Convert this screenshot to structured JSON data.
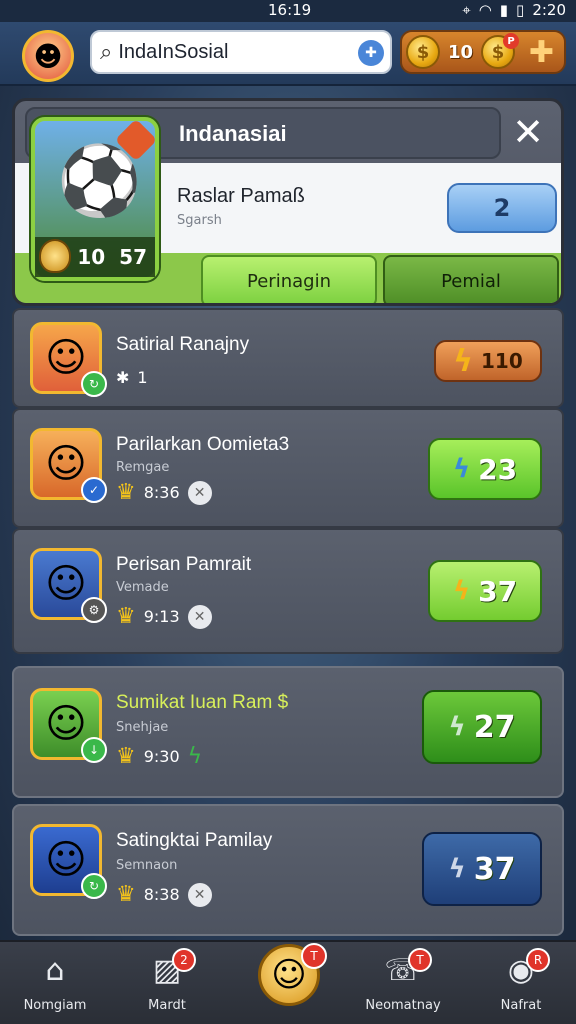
{
  "status": {
    "time_left": "16:19",
    "time_right": "2:20"
  },
  "top": {
    "search_text": "IndaInSosial",
    "currency_value": "10",
    "currency_badge": "P"
  },
  "panel": {
    "title": "Indanasiai",
    "player_name": "Raslar Pamaß",
    "player_sub": "Sgarsh",
    "count": "2",
    "hero_level_a": "10",
    "hero_level_b": "57",
    "tab_left": "Perinagin",
    "tab_right": "Pemial"
  },
  "rows": [
    {
      "name": "Satirial Ranajny",
      "sub": "",
      "meta": "1",
      "pill": "110",
      "style": "orange"
    },
    {
      "name": "Parilarkan Oomieta3",
      "sub": "Remgae",
      "meta": "8:36",
      "pill": "23",
      "style": "green"
    },
    {
      "name": "Perisan Pamrait",
      "sub": "Vemade",
      "meta": "9:13",
      "pill": "37",
      "style": "green"
    },
    {
      "name": "Sumikat Iuan Ram $",
      "sub": "Snehjae",
      "meta": "9:30",
      "pill": "27",
      "style": "dgreen"
    },
    {
      "name": "Satingktai Pamilay",
      "sub": "Semnaon",
      "meta": "8:38",
      "pill": "37",
      "style": "navy"
    }
  ],
  "nav": {
    "home": "Nomgiam",
    "match": "Mardt",
    "match_badge": "2",
    "center_badge": "T",
    "notif": "Neomatnay",
    "notif_badge": "T",
    "profile": "Nafrat",
    "profile_badge": "R"
  },
  "colors": {
    "accent_green": "#7cd040",
    "accent_orange": "#c0642a",
    "accent_blue": "#5d9ce0",
    "badge_red": "#e0342a"
  }
}
